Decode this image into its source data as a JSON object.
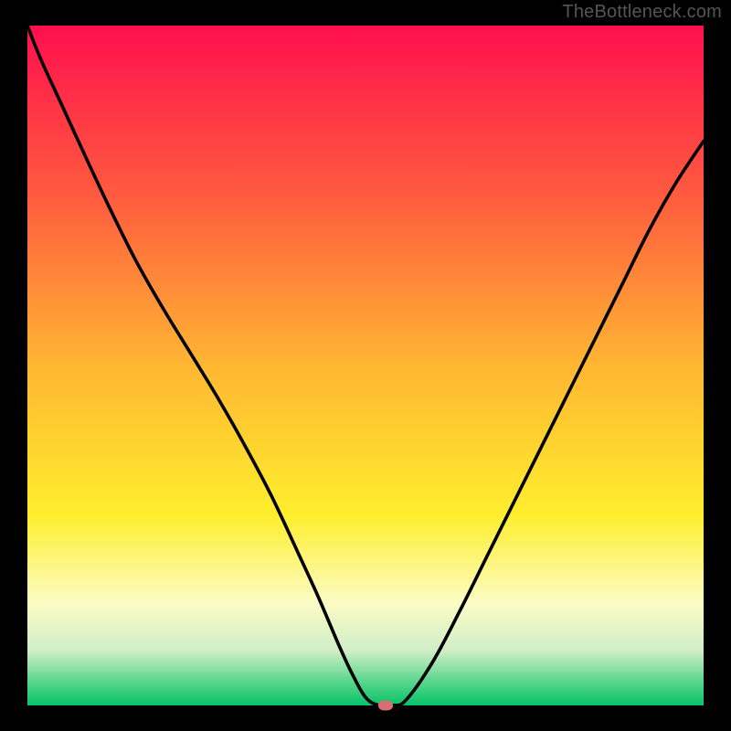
{
  "watermark": "TheBottleneck.com",
  "chart_data": {
    "type": "line",
    "title": "",
    "xlabel": "",
    "ylabel": "",
    "xlim": [
      0,
      100
    ],
    "ylim": [
      0,
      100
    ],
    "grid": false,
    "axes_visible": false,
    "background_gradient": {
      "stops": [
        {
          "pos": 0.0,
          "color": "#ff0f4d"
        },
        {
          "pos": 0.25,
          "color": "#ff5b3f"
        },
        {
          "pos": 0.5,
          "color": "#ffb632"
        },
        {
          "pos": 0.72,
          "color": "#ffee2d"
        },
        {
          "pos": 0.85,
          "color": "#fcfcc5"
        },
        {
          "pos": 0.92,
          "color": "#cfeec6"
        },
        {
          "pos": 0.965,
          "color": "#58d68c"
        },
        {
          "pos": 1.0,
          "color": "#08c268"
        }
      ]
    },
    "series": [
      {
        "name": "bottleneck-curve",
        "color": "#000000",
        "x": [
          0,
          2,
          5,
          8,
          12,
          16,
          20,
          24,
          28,
          32,
          36,
          40,
          43,
          46,
          48,
          50,
          52,
          54,
          56,
          60,
          64,
          68,
          72,
          76,
          80,
          84,
          88,
          92,
          96,
          100
        ],
        "y": [
          100,
          95,
          88.5,
          82,
          73.5,
          65.5,
          58.5,
          52,
          45.5,
          38.5,
          31,
          22.5,
          16,
          9,
          4.7,
          1.2,
          0,
          0,
          0.8,
          6.5,
          14,
          22,
          30,
          38,
          46,
          54,
          62,
          70,
          77,
          83
        ]
      }
    ],
    "marker": {
      "x": 53,
      "y": 0,
      "shape": "pill",
      "color": "#d66e73"
    }
  }
}
